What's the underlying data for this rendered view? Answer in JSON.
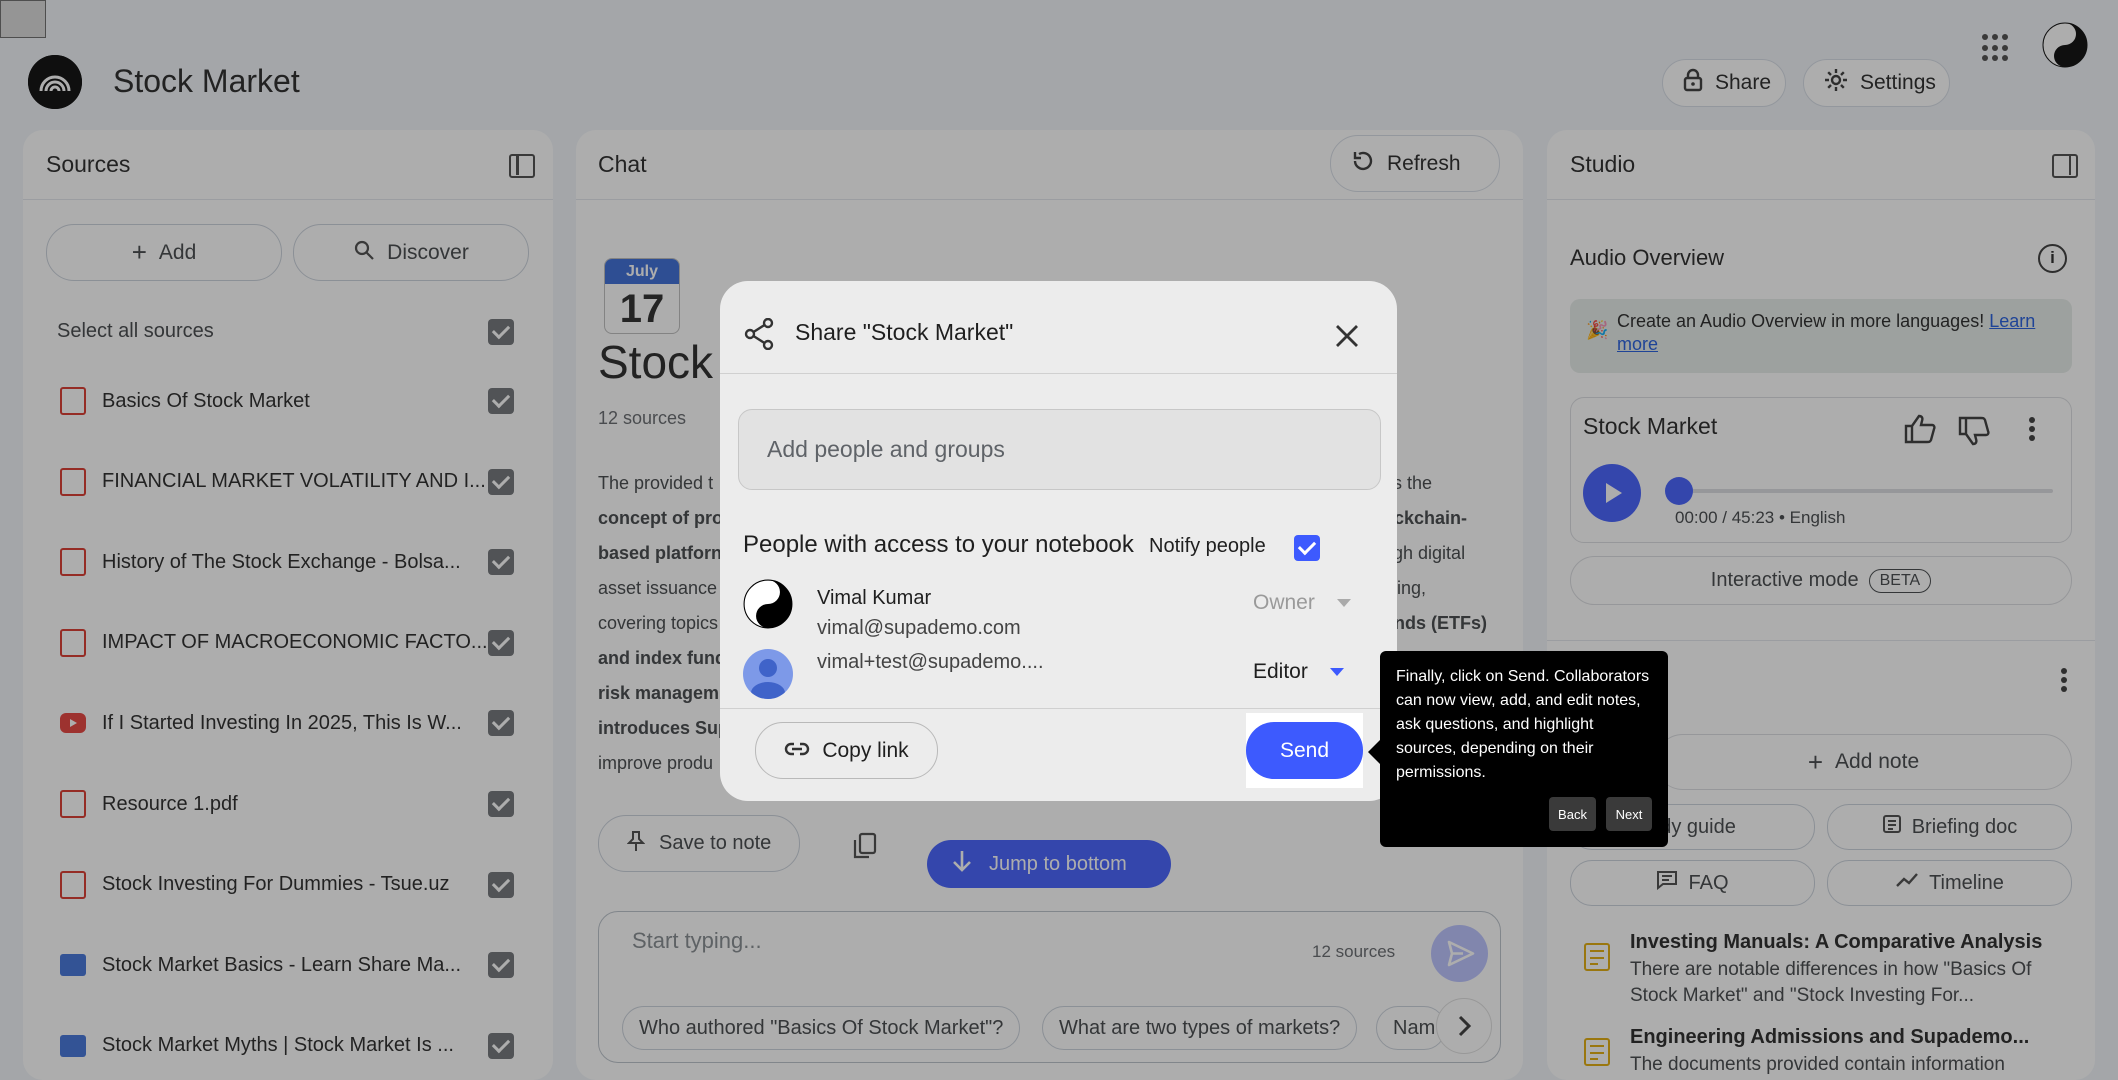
{
  "header": {
    "title": "Stock Market",
    "share_label": "Share",
    "settings_label": "Settings"
  },
  "sources": {
    "title": "Sources",
    "add_label": "Add",
    "discover_label": "Discover",
    "select_all_label": "Select all sources",
    "items": [
      {
        "type": "pdf",
        "label": "Basics Of Stock Market"
      },
      {
        "type": "pdf",
        "label": "FINANCIAL MARKET VOLATILITY AND I..."
      },
      {
        "type": "pdf",
        "label": "History of The Stock Exchange - Bolsa..."
      },
      {
        "type": "pdf",
        "label": "IMPACT OF MACROECONOMIC FACTO..."
      },
      {
        "type": "youtube",
        "label": "If I Started Investing In 2025, This Is W..."
      },
      {
        "type": "pdf",
        "label": "Resource 1.pdf"
      },
      {
        "type": "pdf",
        "label": "Stock Investing For Dummies - Tsue.uz"
      },
      {
        "type": "web",
        "label": "Stock Market Basics - Learn Share Ma..."
      },
      {
        "type": "web",
        "label": "Stock Market Myths | Stock Market Is ..."
      }
    ]
  },
  "chat": {
    "title": "Chat",
    "refresh_label": "Refresh",
    "calendar_month": "July",
    "calendar_day": "17",
    "notebook_title_partial": "Stock",
    "source_count": "12 sources",
    "summary_left": [
      "The provided t",
      "concept of pro",
      "based platforn",
      "asset issuance",
      "covering topics",
      "and index fund",
      "risk managem",
      "introduces Sup",
      "improve produ"
    ],
    "summary_right": [
      "as the",
      "ockchain-",
      "ugh digital",
      "sting,",
      "unds (ETFs)"
    ],
    "save_to_note_label": "Save to note",
    "jump_to_bottom_label": "Jump to bottom",
    "input_placeholder": "Start typing...",
    "input_source_count": "12 sources",
    "suggestions": [
      "Who authored \"Basics Of Stock Market\"?",
      "What are two types of markets?",
      "Nam"
    ]
  },
  "studio": {
    "title": "Studio",
    "audio_overview_title": "Audio Overview",
    "banner_text": "Create an Audio Overview in more languages!",
    "banner_link": "Learn more",
    "audio_card_title": "Stock Market",
    "audio_time": "00:00 / 45:23 • English",
    "audio_progress": 0,
    "interactive_mode_label": "Interactive mode",
    "beta_label": "BETA",
    "add_note_label": "Add note",
    "study_guide_label": "udy guide",
    "briefing_doc_label": "Briefing doc",
    "faq_label": "FAQ",
    "timeline_label": "Timeline",
    "notes": [
      {
        "title": "Investing Manuals: A Comparative Analysis",
        "body": "There are notable differences in how \"Basics Of Stock Market\" and \"Stock Investing For..."
      },
      {
        "title": "Engineering Admissions and Supademo...",
        "body": "The documents provided contain information"
      }
    ]
  },
  "share_dialog": {
    "title": "Share \"Stock Market\"",
    "input_placeholder": "Add people and groups",
    "access_heading": "People with access to your notebook",
    "notify_label": "Notify people",
    "people": [
      {
        "name": "Vimal Kumar",
        "email": "vimal@supademo.com",
        "role": "Owner"
      },
      {
        "name": "",
        "email": "vimal+test@supademo....",
        "role": "Editor"
      }
    ],
    "copy_link_label": "Copy link",
    "send_label": "Send"
  },
  "tooltip": {
    "text": "Finally, click on Send. Collaborators can now view, add, and edit notes, ask questions, and highlight sources, depending on their permissions.",
    "back_label": "Back",
    "next_label": "Next"
  },
  "colors": {
    "accent": "#3d5afe",
    "background": "#f0f4f9",
    "checkbox": "#6b6f73",
    "overlay": "rgba(40,40,40,0.38)"
  }
}
